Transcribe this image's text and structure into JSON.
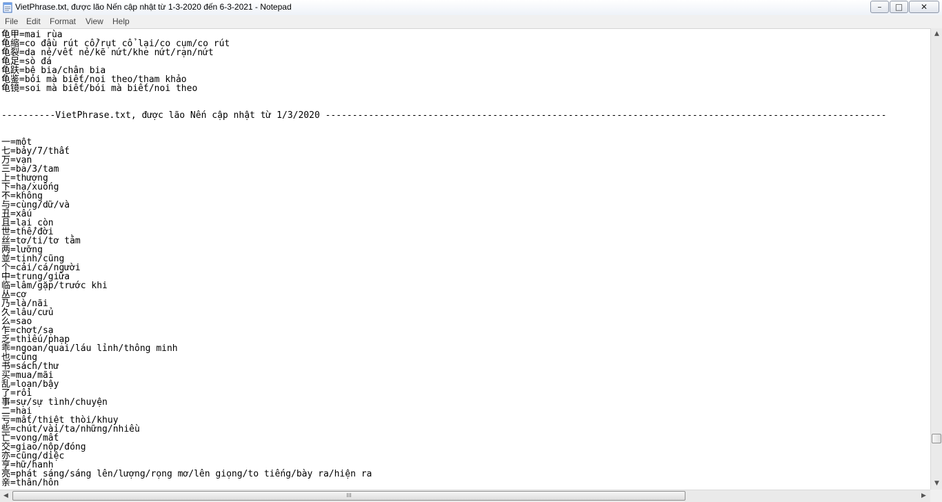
{
  "window": {
    "title": "VietPhrase.txt, được lão Nến cập nhật từ 1-3-2020 đến 6-3-2021 - Notepad",
    "minimize_glyph": "–",
    "maximize_glyph": "□",
    "close_glyph": "✕"
  },
  "menu": [
    "File",
    "Edit",
    "Format",
    "View",
    "Help"
  ],
  "editor": {
    "lines": [
      "龟甲=mai rùa",
      "龟缩=co đầu rút cổ/rụt cổ lại/co cụm/co rút",
      "龟裂=da nẻ/vết nẻ/kẽ nứt/khe nứt/rạn/nứt",
      "龟足=sò đá",
      "龟趺=bệ bia/chân bia",
      "龟鉴=bói mà biết/noi theo/tham khảo",
      "龟镜=soi mà biết/bói mà biết/noi theo",
      "",
      "",
      "----------VietPhrase.txt, được lão Nến cập nhật từ 1/3/2020 --------------------------------------------------------------------------------------------------------",
      "",
      "",
      "一=một",
      "七=bảy/7/thất",
      "万=vạn",
      "三=ba/3/tam",
      "上=thượng",
      "下=hạ/xuống",
      "不=không",
      "与=cùng/dữ/và",
      "丑=xấu",
      "且=lại còn",
      "世=thế/đời",
      "丝=tơ/ti/tơ tằm",
      "两=lưỡng",
      "並=tịnh/cũng",
      "个=cái/cá/người",
      "中=trung/giữa",
      "临=lâm/gặp/trước khi",
      "丛=cơ",
      "乃=là/nãi",
      "久=lâu/cửu",
      "么=sao",
      "乍=chợt/sạ",
      "乏=thiếu/phạp",
      "乖=ngoan/quai/láu lỉnh/thông minh",
      "也=cũng",
      "书=sách/thư",
      "买=mua/mãi",
      "乱=loạn/bậy",
      "了=rồi",
      "事=sự/sự tình/chuyện",
      "二=hai",
      "亏=mất/thiệt thòi/khuy",
      "些=chút/vài/ta/những/nhiều",
      "亡=vong/mất",
      "交=giao/nộp/đóng",
      "亦=cũng/diệc",
      "亨=hữ/hanh",
      "亮=phát sáng/sáng lên/lượng/rọng mơ/lên giọng/to tiếng/bày ra/hiện ra",
      "亲=thân/hôn"
    ]
  },
  "scrollbars": {
    "up_glyph": "▲",
    "down_glyph": "▼",
    "left_glyph": "◀",
    "right_glyph": "▶",
    "grip_glyph": "III",
    "vertical_position_fraction": 0.92
  }
}
